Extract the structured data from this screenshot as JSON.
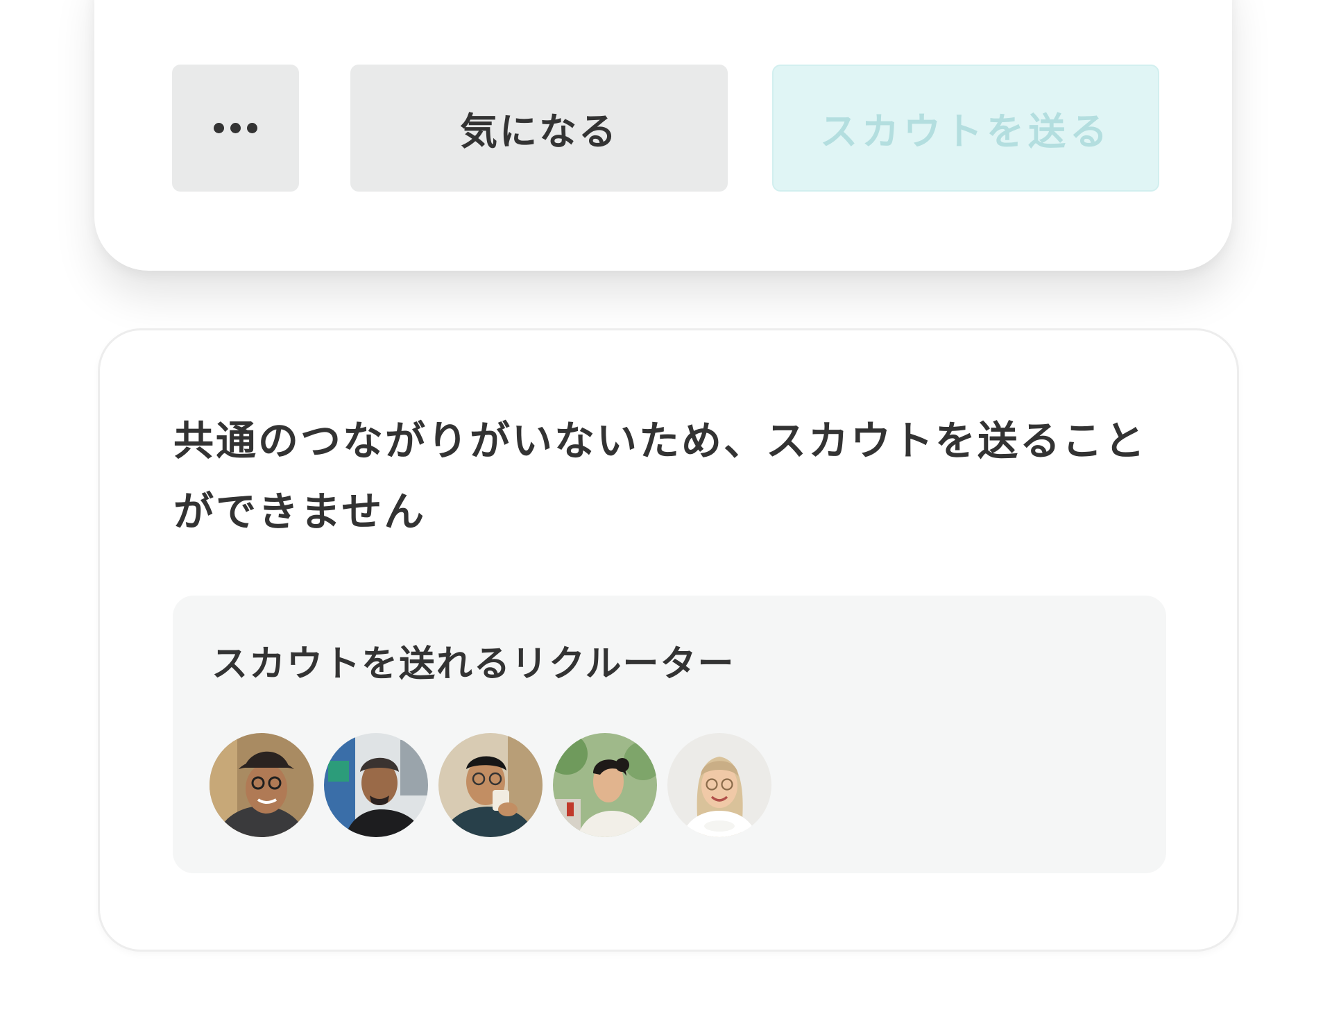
{
  "actions": {
    "more_label": "•••",
    "interest_label": "気になる",
    "scout_label": "スカウトを送る",
    "scout_state": "disabled"
  },
  "info": {
    "message": "共通のつながりがいないため、スカウトを送ることができません",
    "recruiters_title": "スカウトを送れるリクルーター",
    "recruiter_count": 5
  },
  "colors": {
    "scout_bg": "#e0f5f5",
    "scout_text": "#b3dedf",
    "neutral_button": "#e9eaea",
    "panel_bg": "#f5f6f6",
    "text": "#333333"
  }
}
